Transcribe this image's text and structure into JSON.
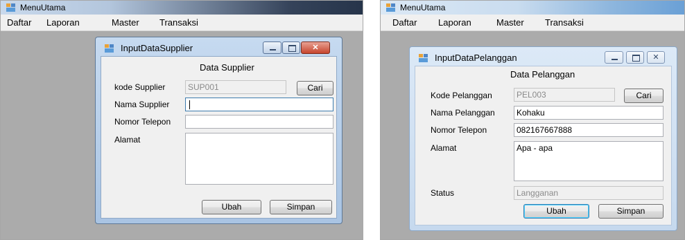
{
  "left_window": {
    "app_title": "MenuUtama",
    "menu": [
      "Daftar",
      "Laporan",
      "Master",
      "Transaksi"
    ],
    "form": {
      "title": "InputDataSupplier",
      "heading": "Data Supplier",
      "fields": {
        "kode_label": "kode Supplier",
        "kode_value": "SUP001",
        "nama_label": "Nama Supplier",
        "nama_value": "",
        "telepon_label": "Nomor Telepon",
        "telepon_value": "",
        "alamat_label": "Alamat",
        "alamat_value": ""
      },
      "buttons": {
        "cari": "Cari",
        "ubah": "Ubah",
        "simpan": "Simpan"
      }
    }
  },
  "right_window": {
    "app_title": "MenuUtama",
    "menu": [
      "Daftar",
      "Laporan",
      "Master",
      "Transaksi"
    ],
    "form": {
      "title": "InputDataPelanggan",
      "heading": "Data Pelanggan",
      "fields": {
        "kode_label": "Kode Pelanggan",
        "kode_value": "PEL003",
        "nama_label": "Nama Pelanggan",
        "nama_value": "Kohaku",
        "telepon_label": "Nomor Telepon",
        "telepon_value": "082167667888",
        "alamat_label": "Alamat",
        "alamat_value": "Apa - apa",
        "status_label": "Status",
        "status_value": "Langganan"
      },
      "buttons": {
        "cari": "Cari",
        "ubah": "Ubah",
        "simpan": "Simpan"
      }
    }
  },
  "icons": [
    "app-form-icon",
    "minimize-icon",
    "maximize-icon",
    "close-icon"
  ]
}
